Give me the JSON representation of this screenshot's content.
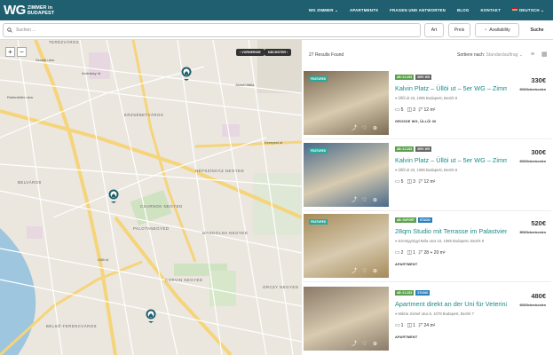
{
  "header": {
    "logo_wg": "WG",
    "logo_line1": "ZIMMER in",
    "logo_line2": "BUDAPEST",
    "nav": [
      {
        "label": "WG ZIMMER",
        "dropdown": true
      },
      {
        "label": "APARTMENTS"
      },
      {
        "label": "FRAGEN UND ANTWORTEN"
      },
      {
        "label": "BLOG"
      },
      {
        "label": "KONTAKT"
      },
      {
        "label": "DEUTSCH",
        "dropdown": true
      }
    ]
  },
  "search": {
    "placeholder": "Suchen ...",
    "filters": {
      "art": "Art",
      "preis": "Preis",
      "availability": "Availability",
      "suche": "Suche"
    }
  },
  "map": {
    "prev_label": "VORHERIGE",
    "next_label": "NÄCHSTER",
    "labels": [
      "TERÉZVÁROS",
      "ERZSÉBETVÁROS",
      "BELVÁROS",
      "NÉPSZÍNHÁZ NEGYED",
      "PALOTANEGYED",
      "CSARNOK NEGYED",
      "MAGDOLNA NEGYED",
      "CORVIN NEGYED",
      "BELSŐ-FERENCVÁROS",
      "ORCZY NEGYED",
      "József Attila",
      "Kerepesi út",
      "Rottenbiller utca",
      "Üllői út",
      "Szondi utca",
      "Andrássy út"
    ]
  },
  "results": {
    "count_text": "27 Results Found",
    "sort_label": "Sortiere nach:",
    "sort_value": "Standardauftrag",
    "listings": [
      {
        "featured": "FEATURED",
        "badges": [
          {
            "text": "AB: 01.2/23",
            "color": "#5aa14b"
          },
          {
            "text": "SER: WG",
            "color": "#666"
          }
        ],
        "title": "Kalvin Platz – Üllöi ut – 5er WG – Zimmer 5",
        "address": "Üllői út 23, 1085 Budapest, Bezirk 8",
        "rooms": "5",
        "baths": "3",
        "size": "12 m²",
        "type": "GROSSE WG, ÜLLŐI 30",
        "price": "330€",
        "extra": "60€/Nebenkosten",
        "img_color": "#7a6a52"
      },
      {
        "featured": "FEATURED",
        "badges": [
          {
            "text": "AB: 01.2/23",
            "color": "#5aa14b"
          },
          {
            "text": "SER: WG",
            "color": "#666"
          }
        ],
        "title": "Kalvin Platz – Üllöi ut – 5er WG – Zimmer 4",
        "address": "Üllői út 23, 1085 Budapest, Bezirk 8",
        "rooms": "5",
        "baths": "3",
        "size": "12 m²",
        "type": "",
        "price": "300€",
        "extra": "60€/Nebenkosten",
        "img_color": "#4a6a8a"
      },
      {
        "featured": "FEATURED",
        "badges": [
          {
            "text": "AB: SOFORT",
            "color": "#5aa14b"
          },
          {
            "text": "STUDIO",
            "color": "#2b7fbf"
          }
        ],
        "title": "28qm Studio mit Terrasse im Palastviertel",
        "address": "Szentgyörgyi Béla utca 10, 1085 Budapest, Bezirk 8",
        "rooms": "2",
        "baths": "1",
        "size": "28 + 20 m²",
        "type": "APARTMENT",
        "price": "520€",
        "extra": "90€/Nebenkosten",
        "img_color": "#a58a5a"
      },
      {
        "featured": "",
        "badges": [
          {
            "text": "AB: 01.2/23",
            "color": "#5aa14b"
          },
          {
            "text": "STUDIO",
            "color": "#2b7fbf"
          }
        ],
        "title": "Apartment direkt an der Uni für Veterinärme...",
        "address": "Mátrai József utca 6, 1078 Budapest, Bezirk 7",
        "rooms": "1",
        "baths": "1",
        "size": "24 m²",
        "type": "APARTMENT",
        "price": "480€",
        "extra": "60€/Nebenkosten",
        "img_color": "#8a7a68"
      }
    ]
  }
}
